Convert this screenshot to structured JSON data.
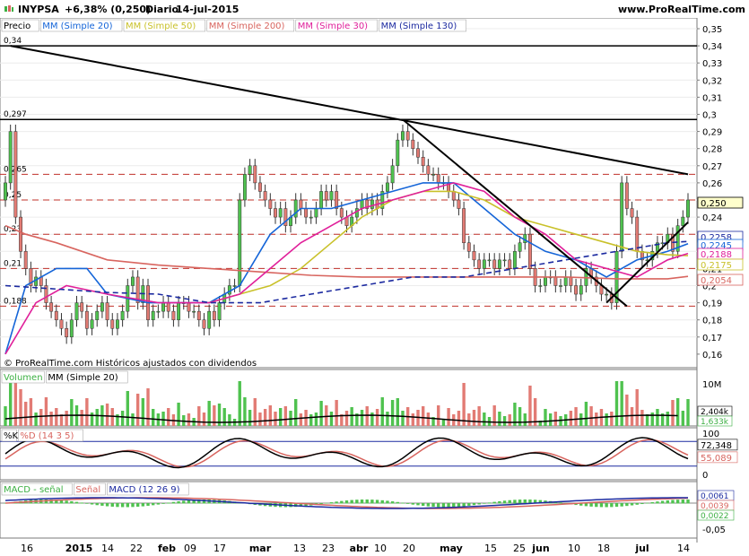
{
  "header": {
    "symbol": "INYPSA",
    "change": "+6,38% (0,250)",
    "period": "Diario",
    "date": "14-jul-2015",
    "brand": "www.ProRealTime.com"
  },
  "main_panel": {
    "legend": [
      {
        "label": "Precio",
        "color": "#000000"
      },
      {
        "label": "MM (Simple 20)",
        "color": "#1565d8"
      },
      {
        "label": "MM (Simple 50)",
        "color": "#c9c12a"
      },
      {
        "label": "MM (Simple 200)",
        "color": "#d8655f"
      },
      {
        "label": "MM (Simple 30)",
        "color": "#e0209a"
      },
      {
        "label": "MM (Simple 130)",
        "color": "#1c2aa0"
      }
    ],
    "y_ticks": [
      "0,35",
      "0,34",
      "0,33",
      "0,32",
      "0,31",
      "0,3",
      "0,29",
      "0,28",
      "0,27",
      "0,26",
      "0,25",
      "0,24",
      "0,23",
      "0,22",
      "0,21",
      "0,2",
      "0,19",
      "0,18",
      "0,17",
      "0,16"
    ],
    "hline_labels": [
      "0,34",
      "0,297",
      "0,265",
      "0,25",
      "0,23",
      "0,21",
      "0,188"
    ],
    "price_tags": [
      {
        "text": "0,250",
        "bg": "#ffffcc",
        "fg": "#000000"
      },
      {
        "text": "0,2258",
        "bg": "#ffffff",
        "fg": "#1c2aa0"
      },
      {
        "text": "0,2245",
        "bg": "#ffffff",
        "fg": "#1565d8"
      },
      {
        "text": "0,2188",
        "bg": "#ffffff",
        "fg": "#e0209a"
      },
      {
        "text": "0,2175",
        "bg": "#ffffff",
        "fg": "#c9c12a"
      },
      {
        "text": "0,2054",
        "bg": "#ffffff",
        "fg": "#d8655f"
      }
    ],
    "footer": "© ProRealTime.com  Históricos ajustados con dividendos"
  },
  "volume_panel": {
    "legend": [
      {
        "label": "Volumen",
        "color": "#3cb043"
      },
      {
        "label": "MM (Simple 20)",
        "color": "#000000"
      }
    ],
    "y_ticks": [
      "10M"
    ],
    "tags": [
      {
        "text": "2,404k",
        "fg": "#000000"
      },
      {
        "text": "1,633k",
        "fg": "#3cb043"
      }
    ]
  },
  "stoch_panel": {
    "legend": [
      {
        "label": "%K",
        "color": "#000000"
      },
      {
        "label": "%D (14 3 5)",
        "color": "#d8655f"
      }
    ],
    "y_ticks": [
      "100",
      "0"
    ],
    "tags": [
      {
        "text": "72,348",
        "fg": "#000000"
      },
      {
        "text": "55,089",
        "fg": "#d8655f"
      }
    ]
  },
  "macd_panel": {
    "legend": [
      {
        "label": "MACD - señal",
        "color": "#3cb043"
      },
      {
        "label": "Señal",
        "color": "#d8655f"
      },
      {
        "label": "MACD (12 26 9)",
        "color": "#1c2aa0"
      }
    ],
    "y_ticks": [
      "-0,05"
    ],
    "tags": [
      {
        "text": "0,0061",
        "fg": "#1c2aa0"
      },
      {
        "text": "0,0039",
        "fg": "#d8655f"
      },
      {
        "text": "0,0022",
        "fg": "#3cb043"
      }
    ]
  },
  "x_axis": [
    "16",
    "2015",
    "14",
    "22",
    "feb",
    "09",
    "17",
    "mar",
    "13",
    "23",
    "abr",
    "10",
    "20",
    "may",
    "15",
    "25",
    "jun",
    "10",
    "18",
    "jul",
    "14"
  ],
  "chart_data": {
    "type": "candlestick",
    "title": "INYPSA +6,38% (0,250) Diario 14-jul-2015",
    "xlabel": "",
    "ylabel": "",
    "ylim": [
      0.155,
      0.355
    ],
    "grid": true,
    "x_tick_labels": [
      "16",
      "2015",
      "14",
      "22",
      "feb",
      "09",
      "17",
      "mar",
      "13",
      "23",
      "abr",
      "10",
      "20",
      "may",
      "15",
      "25",
      "jun",
      "10",
      "18",
      "jul",
      "14"
    ],
    "horizontal_levels": [
      0.34,
      0.297,
      0.265,
      0.25,
      0.23,
      0.21,
      0.188
    ],
    "series": [
      {
        "name": "Precio",
        "close": [
          0.26,
          0.29,
          0.24,
          0.22,
          0.21,
          0.2,
          0.205,
          0.2,
          0.19,
          0.185,
          0.18,
          0.175,
          0.17,
          0.18,
          0.19,
          0.185,
          0.175,
          0.18,
          0.185,
          0.19,
          0.18,
          0.175,
          0.18,
          0.185,
          0.2,
          0.205,
          0.19,
          0.2,
          0.18,
          0.185,
          0.185,
          0.19,
          0.185,
          0.18,
          0.19,
          0.19,
          0.185,
          0.185,
          0.18,
          0.175,
          0.185,
          0.18,
          0.19,
          0.195,
          0.2,
          0.2,
          0.25,
          0.265,
          0.27,
          0.26,
          0.255,
          0.25,
          0.245,
          0.24,
          0.245,
          0.235,
          0.24,
          0.25,
          0.245,
          0.24,
          0.24,
          0.245,
          0.255,
          0.25,
          0.255,
          0.245,
          0.24,
          0.235,
          0.24,
          0.245,
          0.25,
          0.245,
          0.25,
          0.245,
          0.255,
          0.26,
          0.27,
          0.285,
          0.29,
          0.285,
          0.28,
          0.275,
          0.27,
          0.265,
          0.265,
          0.26,
          0.26,
          0.255,
          0.25,
          0.245,
          0.225,
          0.22,
          0.215,
          0.21,
          0.215,
          0.215,
          0.21,
          0.215,
          0.215,
          0.21,
          0.22,
          0.225,
          0.23,
          0.21,
          0.2,
          0.2,
          0.205,
          0.205,
          0.2,
          0.2,
          0.205,
          0.2,
          0.195,
          0.2,
          0.21,
          0.205,
          0.2,
          0.195,
          0.195,
          0.19,
          0.22,
          0.26,
          0.245,
          0.24,
          0.22,
          0.215,
          0.215,
          0.22,
          0.225,
          0.225,
          0.23,
          0.22,
          0.235,
          0.24,
          0.25
        ]
      },
      {
        "name": "MM (Simple 20)",
        "points": [
          [
            0,
            0.16
          ],
          [
            4,
            0.2
          ],
          [
            10,
            0.21
          ],
          [
            16,
            0.21
          ],
          [
            20,
            0.195
          ],
          [
            28,
            0.19
          ],
          [
            34,
            0.19
          ],
          [
            40,
            0.19
          ],
          [
            46,
            0.2
          ],
          [
            52,
            0.23
          ],
          [
            58,
            0.245
          ],
          [
            64,
            0.245
          ],
          [
            70,
            0.25
          ],
          [
            76,
            0.255
          ],
          [
            82,
            0.26
          ],
          [
            88,
            0.26
          ],
          [
            94,
            0.245
          ],
          [
            100,
            0.23
          ],
          [
            106,
            0.22
          ],
          [
            112,
            0.215
          ],
          [
            118,
            0.205
          ],
          [
            124,
            0.215
          ],
          [
            130,
            0.22
          ],
          [
            134,
            0.2245
          ]
        ]
      },
      {
        "name": "MM (Simple 50)",
        "points": [
          [
            40,
            0.19
          ],
          [
            46,
            0.195
          ],
          [
            52,
            0.2
          ],
          [
            58,
            0.21
          ],
          [
            64,
            0.225
          ],
          [
            70,
            0.24
          ],
          [
            76,
            0.25
          ],
          [
            82,
            0.255
          ],
          [
            88,
            0.255
          ],
          [
            94,
            0.25
          ],
          [
            100,
            0.24
          ],
          [
            106,
            0.235
          ],
          [
            112,
            0.23
          ],
          [
            118,
            0.225
          ],
          [
            124,
            0.22
          ],
          [
            130,
            0.218
          ],
          [
            134,
            0.2175
          ]
        ]
      },
      {
        "name": "MM (Simple 200)",
        "points": [
          [
            0,
            0.235
          ],
          [
            4,
            0.23
          ],
          [
            10,
            0.225
          ],
          [
            20,
            0.215
          ],
          [
            30,
            0.212
          ],
          [
            40,
            0.21
          ],
          [
            50,
            0.208
          ],
          [
            60,
            0.206
          ],
          [
            70,
            0.205
          ],
          [
            80,
            0.205
          ],
          [
            90,
            0.205
          ],
          [
            100,
            0.205
          ],
          [
            110,
            0.205
          ],
          [
            120,
            0.204
          ],
          [
            130,
            0.204
          ],
          [
            134,
            0.2054
          ]
        ]
      },
      {
        "name": "MM (Simple 30)",
        "points": [
          [
            0,
            0.16
          ],
          [
            6,
            0.19
          ],
          [
            12,
            0.2
          ],
          [
            20,
            0.195
          ],
          [
            30,
            0.19
          ],
          [
            40,
            0.19
          ],
          [
            46,
            0.195
          ],
          [
            52,
            0.21
          ],
          [
            58,
            0.225
          ],
          [
            64,
            0.235
          ],
          [
            70,
            0.245
          ],
          [
            76,
            0.25
          ],
          [
            82,
            0.255
          ],
          [
            88,
            0.26
          ],
          [
            94,
            0.255
          ],
          [
            100,
            0.24
          ],
          [
            106,
            0.23
          ],
          [
            112,
            0.215
          ],
          [
            118,
            0.21
          ],
          [
            124,
            0.205
          ],
          [
            130,
            0.215
          ],
          [
            134,
            0.2188
          ]
        ]
      },
      {
        "name": "MM (Simple 130)",
        "points": [
          [
            0,
            0.2
          ],
          [
            10,
            0.198
          ],
          [
            20,
            0.196
          ],
          [
            30,
            0.195
          ],
          [
            40,
            0.19
          ],
          [
            50,
            0.19
          ],
          [
            60,
            0.195
          ],
          [
            70,
            0.2
          ],
          [
            80,
            0.205
          ],
          [
            90,
            0.205
          ],
          [
            100,
            0.21
          ],
          [
            110,
            0.215
          ],
          [
            120,
            0.22
          ],
          [
            130,
            0.225
          ],
          [
            134,
            0.2258
          ]
        ]
      }
    ],
    "trendlines": [
      {
        "from": [
          1,
          0.34
        ],
        "to": [
          134,
          0.265
        ]
      },
      {
        "from": [
          78,
          0.297
        ],
        "to": [
          122,
          0.188
        ]
      },
      {
        "from": [
          118,
          0.19
        ],
        "to": [
          134,
          0.237
        ]
      }
    ],
    "volume": {
      "ylim": [
        0,
        10000000
      ],
      "ma20_last": 2404000,
      "last": 1633000
    },
    "stochastic": {
      "ylim": [
        0,
        100
      ],
      "k_last": 72.348,
      "d_last": 55.089
    },
    "macd": {
      "macd_last": 0.0061,
      "signal_last": 0.0039,
      "hist_last": 0.0022
    }
  }
}
